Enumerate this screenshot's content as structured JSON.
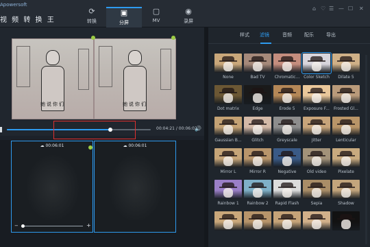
{
  "app": {
    "logo_small": "Apowersoft",
    "logo_title": "视 频 转 换 王"
  },
  "top_tabs": [
    {
      "label": "转换",
      "icon": "refresh-icon",
      "glyph": "⟳"
    },
    {
      "label": "分屏",
      "icon": "split-screen-icon",
      "glyph": "▣"
    },
    {
      "label": "MV",
      "icon": "tv-icon",
      "glyph": "▢"
    },
    {
      "label": "录屏",
      "icon": "record-icon",
      "glyph": "◉"
    }
  ],
  "active_top_tab": "分屏",
  "window_controls": [
    "⌂",
    "♡",
    "☰",
    "—",
    "☐",
    "✕"
  ],
  "preview": {
    "caption": "她说你们",
    "time_current": "00:04:21",
    "time_total": "00:06:02",
    "progress": 0.72
  },
  "clips": [
    {
      "duration": "00:06:01"
    },
    {
      "duration": "00:06:01"
    }
  ],
  "clip_tools": {
    "cut": "✂",
    "volume": "🔊",
    "minus": "−",
    "plus": "+"
  },
  "sub_tabs": [
    {
      "label": "样式"
    },
    {
      "label": "滤镜"
    },
    {
      "label": "音频"
    },
    {
      "label": "配乐"
    },
    {
      "label": "导出"
    }
  ],
  "active_sub_tab": "滤镜",
  "filters": [
    {
      "name": "None",
      "bg": "#c9a77a"
    },
    {
      "name": "Bad TV",
      "bg": "#a5897a"
    },
    {
      "name": "Chromatic...",
      "bg": "#c48d7e"
    },
    {
      "name": "Color Sketch",
      "bg": "#d8d5dc",
      "selected": true
    },
    {
      "name": "Dilate 5",
      "bg": "#cfb087"
    },
    {
      "name": "Dot matrix",
      "bg": "#6b5734"
    },
    {
      "name": "Edge",
      "bg": "#1a1a1a"
    },
    {
      "name": "Erode 5",
      "bg": "#b48757"
    },
    {
      "name": "Exposure F...",
      "bg": "#e9c79a"
    },
    {
      "name": "Frosted Gl...",
      "bg": "#b99a7a"
    },
    {
      "name": "Gaussian B...",
      "bg": "#c4a274"
    },
    {
      "name": "Glitch",
      "bg": "#d3b9a7"
    },
    {
      "name": "Greyscale",
      "bg": "#8d8d8d"
    },
    {
      "name": "Jitter",
      "bg": "#c7a47a"
    },
    {
      "name": "Lenticular",
      "bg": "#b99568"
    },
    {
      "name": "Mirror L",
      "bg": "#c6a578"
    },
    {
      "name": "Mirror R",
      "bg": "#b8956b"
    },
    {
      "name": "Negative",
      "bg": "#3a5a86"
    },
    {
      "name": "Old video",
      "bg": "#a29279"
    },
    {
      "name": "Pixelate",
      "bg": "#c8aa7f"
    },
    {
      "name": "Rainbow 1",
      "bg": "#9a7fc7"
    },
    {
      "name": "Rainbow 2",
      "bg": "#7fb0c7"
    },
    {
      "name": "Rapid Flash",
      "bg": "#dcdcdc"
    },
    {
      "name": "Sepia",
      "bg": "#a98d67"
    },
    {
      "name": "Shadow",
      "bg": "#c3a57c"
    },
    {
      "name": "",
      "bg": "#c9a77a"
    },
    {
      "name": "",
      "bg": "#b7946a"
    },
    {
      "name": "",
      "bg": "#c5a378"
    },
    {
      "name": "",
      "bg": "#d1b08a"
    },
    {
      "name": "",
      "bg": "#121212"
    }
  ],
  "colors": {
    "accent": "#2e9bf0",
    "highlight": "#e0302f",
    "indicator": "#9ccc44"
  }
}
